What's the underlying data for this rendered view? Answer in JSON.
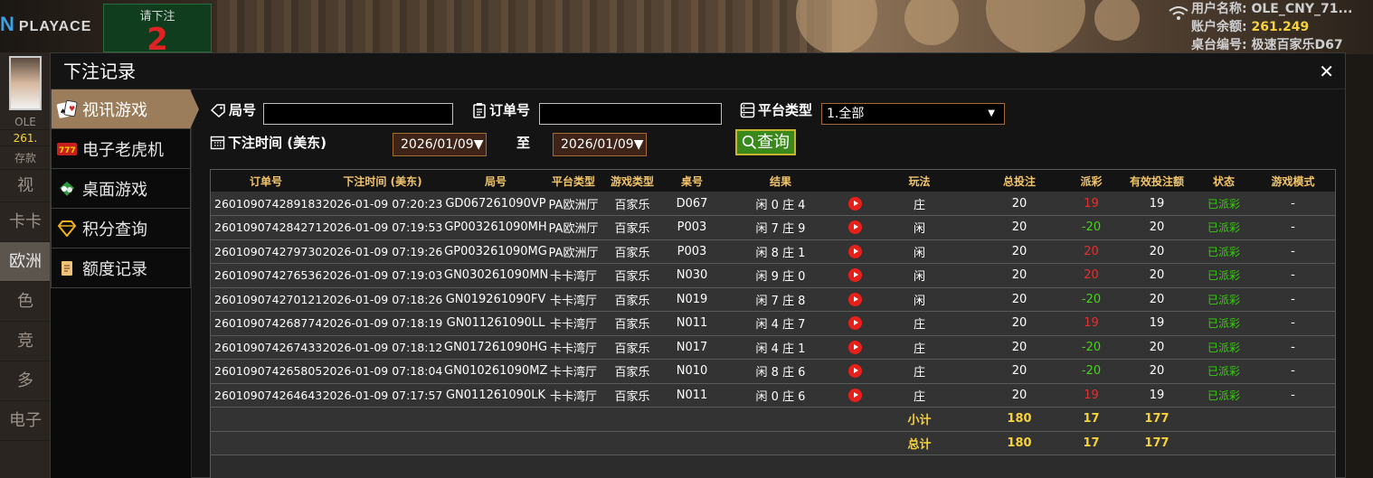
{
  "background": {
    "logo_text": "PLAYACE",
    "bet_prompt": "请下注",
    "bet_countdown": "2",
    "user_name_line": "用户名称: OLE_CNY_71...",
    "balance_label": "账户余额: ",
    "balance_value": "261.249",
    "table_line": "桌台编号: 极速百家乐D67",
    "left_nav": [
      "OLE",
      "261.",
      "存款",
      "视",
      "卡卡",
      "欧洲",
      "色",
      "竞",
      "多",
      "电子"
    ]
  },
  "modal": {
    "title": "下注记录",
    "close_icon": "close-icon",
    "sidebar": [
      {
        "label": "视讯游戏",
        "icon": "poker-cards-icon",
        "active": true
      },
      {
        "label": "电子老虎机",
        "icon": "slot-777-icon",
        "active": false
      },
      {
        "label": "桌面游戏",
        "icon": "table-game-icon",
        "active": false
      },
      {
        "label": "积分查询",
        "icon": "diamond-icon",
        "active": false
      },
      {
        "label": "额度记录",
        "icon": "document-icon",
        "active": false
      }
    ],
    "filters": {
      "round_label": "局号",
      "round_value": "",
      "order_label": "订单号",
      "order_value": "",
      "platform_label": "平台类型",
      "platform_value": "1.全部",
      "time_label": "下注时间 (美东)",
      "date_from": "2026/01/09",
      "to_label": "至",
      "date_to": "2026/01/09",
      "query_label": "查询"
    },
    "table": {
      "headers": [
        "订单号",
        "下注时间 (美东)",
        "局号",
        "平台类型",
        "游戏类型",
        "桌号",
        "结果",
        "",
        "玩法",
        "总投注",
        "派彩",
        "有效投注额",
        "状态",
        "游戏模式"
      ],
      "rows": [
        [
          "260109074289183",
          "2026-01-09 07:20:23",
          "GD067261090VP",
          "PA欧洲厅",
          "百家乐",
          "D067",
          "闲 0 庄 4",
          "",
          "庄",
          "20",
          "19",
          "19",
          "已派彩",
          "-"
        ],
        [
          "260109074284271",
          "2026-01-09 07:19:53",
          "GP003261090MH",
          "PA欧洲厅",
          "百家乐",
          "P003",
          "闲 7 庄 9",
          "",
          "闲",
          "20",
          "-20",
          "20",
          "已派彩",
          "-"
        ],
        [
          "260109074279730",
          "2026-01-09 07:19:26",
          "GP003261090MG",
          "PA欧洲厅",
          "百家乐",
          "P003",
          "闲 8 庄 1",
          "",
          "闲",
          "20",
          "20",
          "20",
          "已派彩",
          "-"
        ],
        [
          "260109074276536",
          "2026-01-09 07:19:03",
          "GN030261090MN",
          "卡卡湾厅",
          "百家乐",
          "N030",
          "闲 9 庄 0",
          "",
          "闲",
          "20",
          "20",
          "20",
          "已派彩",
          "-"
        ],
        [
          "260109074270121",
          "2026-01-09 07:18:26",
          "GN019261090FV",
          "卡卡湾厅",
          "百家乐",
          "N019",
          "闲 7 庄 8",
          "",
          "闲",
          "20",
          "-20",
          "20",
          "已派彩",
          "-"
        ],
        [
          "260109074268774",
          "2026-01-09 07:18:19",
          "GN011261090LL",
          "卡卡湾厅",
          "百家乐",
          "N011",
          "闲 4 庄 7",
          "",
          "庄",
          "20",
          "19",
          "19",
          "已派彩",
          "-"
        ],
        [
          "260109074267433",
          "2026-01-09 07:18:12",
          "GN017261090HG",
          "卡卡湾厅",
          "百家乐",
          "N017",
          "闲 4 庄 1",
          "",
          "庄",
          "20",
          "-20",
          "20",
          "已派彩",
          "-"
        ],
        [
          "260109074265805",
          "2026-01-09 07:18:04",
          "GN010261090MZ",
          "卡卡湾厅",
          "百家乐",
          "N010",
          "闲 8 庄 6",
          "",
          "庄",
          "20",
          "-20",
          "20",
          "已派彩",
          "-"
        ],
        [
          "260109074264643",
          "2026-01-09 07:17:57",
          "GN011261090LK",
          "卡卡湾厅",
          "百家乐",
          "N011",
          "闲 0 庄 6",
          "",
          "庄",
          "20",
          "19",
          "19",
          "已派彩",
          "-"
        ]
      ],
      "subtotal": {
        "label": "小计",
        "total_bet": "180",
        "payout": "17",
        "valid_bet": "177"
      },
      "total": {
        "label": "总计",
        "total_bet": "180",
        "payout": "17",
        "valid_bet": "177"
      }
    }
  },
  "colors": {
    "accent": "#9b7d5b",
    "header_text": "#f2c56b",
    "win": "#e23131",
    "loss": "#49d11d",
    "sum": "#f7d23a",
    "query_btn": "#39891d"
  }
}
